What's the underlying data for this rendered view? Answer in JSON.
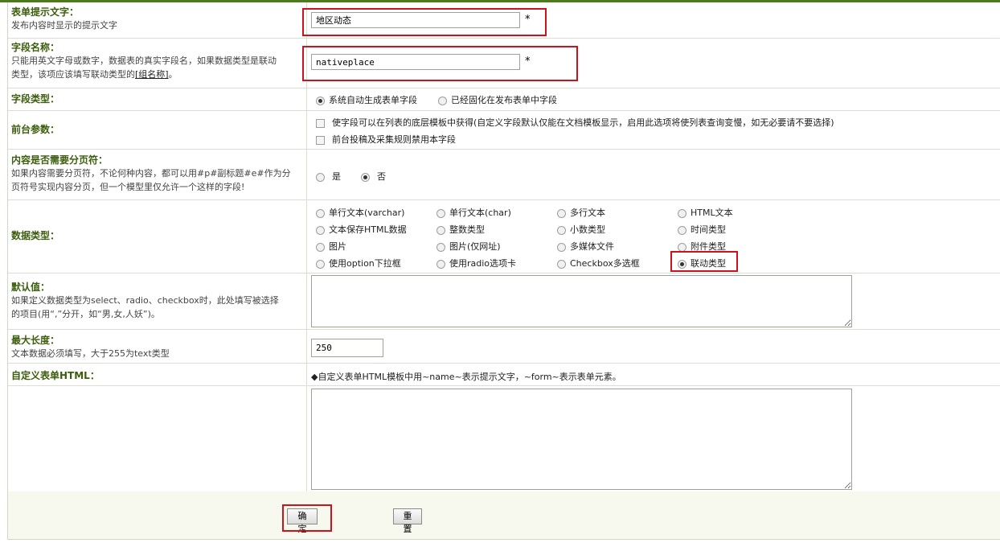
{
  "fields": {
    "form_prompt": {
      "label": "表单提示文字：",
      "hint": "发布内容时显示的提示文字",
      "value": "地区动态",
      "required": "*"
    },
    "field_name": {
      "label": "字段名称：",
      "hint_line1": "只能用英文字母或数字，数据表的真实字段名，如果数据类型是联动",
      "hint_line2_prefix": "类型，该项应该填写联动类型的",
      "hint_link": "[组名称]",
      "hint_line2_suffix": "。",
      "value": "nativeplace",
      "required": "*"
    },
    "field_type": {
      "label": "字段类型：",
      "options": [
        "系统自动生成表单字段",
        "已经固化在发布表单中字段"
      ],
      "selected": 0
    },
    "front_params": {
      "label": "前台参数：",
      "options": [
        "使字段可以在列表的底层模板中获得(自定义字段默认仅能在文档模板显示，启用此选项将使列表查询变慢，如无必要请不要选择)",
        "前台投稿及采集规则禁用本字段"
      ]
    },
    "pagination": {
      "label": "内容是否需要分页符：",
      "hint_line1": "如果内容需要分页符，不论何种内容，都可以用#p#副标题#e#作为分",
      "hint_line2": "页符号实现内容分页，但一个模型里仅允许一个这样的字段!",
      "options": [
        "是",
        "否"
      ],
      "selected": 1
    },
    "data_type": {
      "label": "数据类型：",
      "options": [
        "单行文本(varchar)",
        "单行文本(char)",
        "多行文本",
        "HTML文本",
        "文本保存HTML数据",
        "整数类型",
        "小数类型",
        "时间类型",
        "图片",
        "图片(仅网址)",
        "多媒体文件",
        "附件类型",
        "使用option下拉框",
        "使用radio选项卡",
        "Checkbox多选框",
        "联动类型"
      ],
      "selected": 15
    },
    "default_value": {
      "label": "默认值：",
      "hint_line1": "如果定义数据类型为select、radio、checkbox时，此处填写被选择",
      "hint_line2": "的项目(用“,”分开，如“男,女,人妖”)。",
      "value": ""
    },
    "max_length": {
      "label": "最大长度：",
      "hint": "文本数据必须填写，大于255为text类型",
      "value": "250"
    },
    "custom_html": {
      "label": "自定义表单HTML：",
      "note": "◆自定义表单HTML模板中用~name~表示提示文字，~form~表示表单元素。",
      "value": ""
    }
  },
  "buttons": {
    "confirm": "确定",
    "reset": "重置"
  },
  "colors": {
    "label_green": "#3b5d0c",
    "highlight_red": "#d0111b",
    "footer_bg": "#f7f9ee"
  }
}
